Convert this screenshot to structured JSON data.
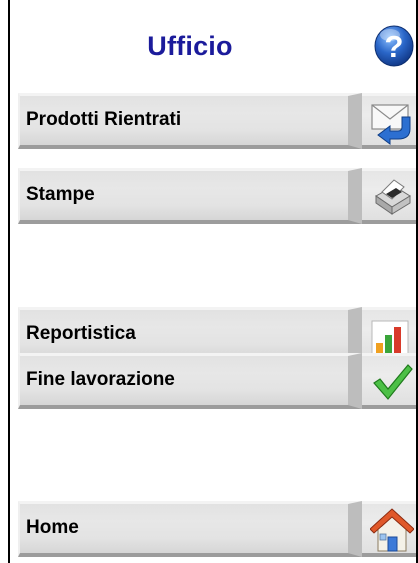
{
  "header": {
    "title": "Ufficio",
    "help_icon": "question-mark-icon"
  },
  "menu": {
    "items": [
      {
        "id": "prodotti-rientrati",
        "label": "Prodotti Rientrati",
        "icon": "mail-return-icon"
      },
      {
        "id": "stampe",
        "label": "Stampe",
        "icon": "printer-icon"
      },
      {
        "id": "reportistica",
        "label": "Reportistica",
        "icon": "bar-chart-icon"
      },
      {
        "id": "fine-lavorazione",
        "label": "Fine lavorazione",
        "icon": "checkmark-icon"
      },
      {
        "id": "home",
        "label": "Home",
        "icon": "house-icon"
      }
    ]
  },
  "colors": {
    "title": "#1b1b9b",
    "button_face": "#e3e3e3",
    "help_blue": "#2a66c8",
    "checkmark": "#3fa83a",
    "house_roof": "#e0582a"
  }
}
